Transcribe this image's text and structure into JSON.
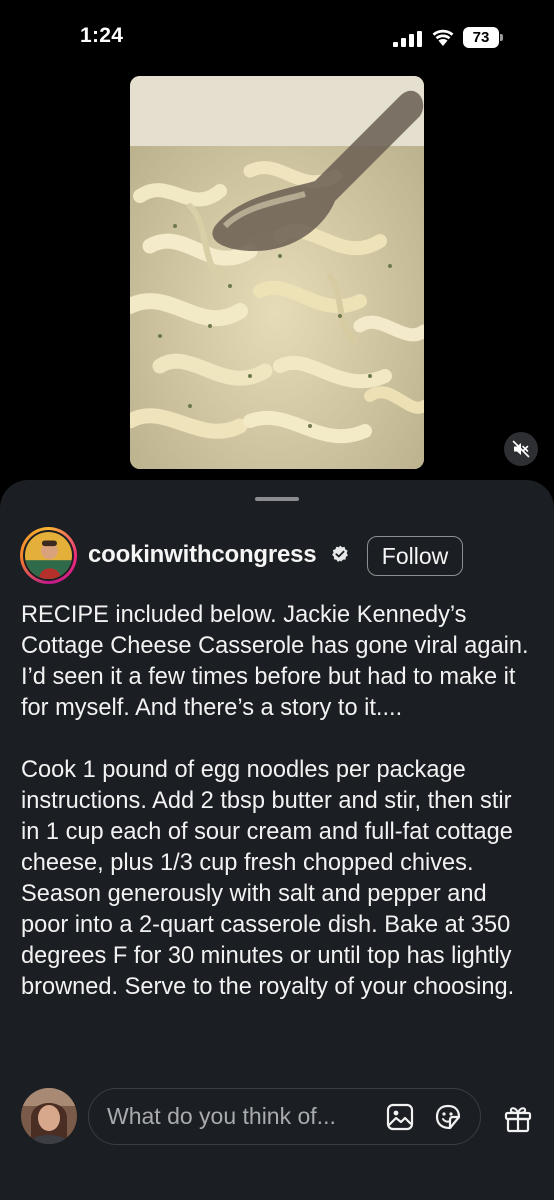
{
  "status_bar": {
    "time": "1:24",
    "battery": "73"
  },
  "post": {
    "username": "cookinwithcongress",
    "follow_label": "Follow",
    "caption_paragraphs": [
      "RECIPE included below. Jackie Kennedy’s Cottage Cheese Casserole has gone viral again. I’d seen it a few times before but had to make it for myself. And there’s a story to it....",
      "Cook 1 pound of egg noodles per package instructions. Add 2 tbsp butter and stir, then stir in 1 cup each of sour cream and full-fat cottage cheese, plus 1/3 cup fresh chopped chives. Season generously with salt and pepper and poor into a 2-quart casserole dish. Bake at 350 degrees F for 30 minutes or until top has lightly browned. Serve to the royalty of your choosing."
    ]
  },
  "comment": {
    "placeholder": "What do you think of..."
  },
  "icons": {
    "verified": "verified-badge-icon",
    "mute": "speaker-muted-icon",
    "image": "image-icon",
    "sticker": "sticker-icon",
    "gift": "gift-icon"
  },
  "colors": {
    "sheet_background": "#1b1e22",
    "app_background": "#000000",
    "text": "#f5f5f5",
    "placeholder": "#a8aaae"
  }
}
